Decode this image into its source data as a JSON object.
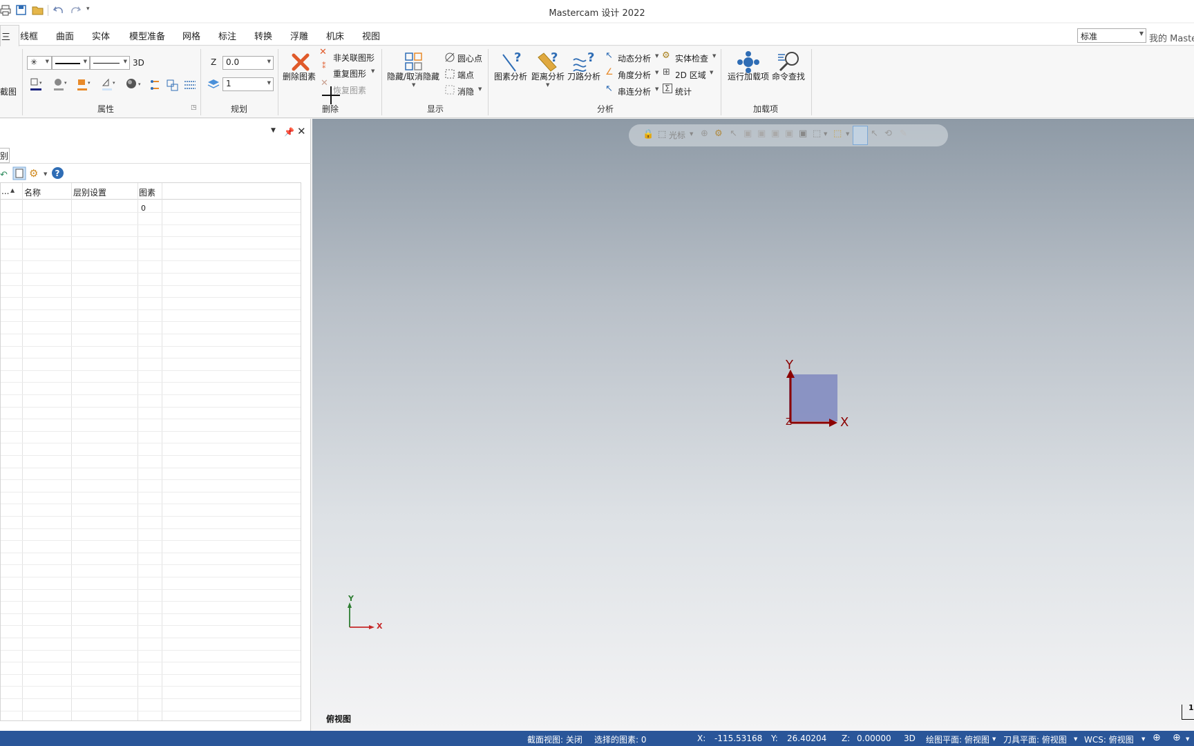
{
  "app": {
    "title": "Mastercam 设计 2022"
  },
  "tabs": [
    "线框",
    "曲面",
    "实体",
    "模型准备",
    "网格",
    "标注",
    "转换",
    "浮雕",
    "机床",
    "视图"
  ],
  "current_tab_fragment": "三",
  "standard_combo": "标准",
  "my_label": "我的 Maste",
  "ribbon": {
    "left_cut_label": "截图",
    "attributes": {
      "label": "属性",
      "point_style": "✳",
      "three_d": "3D"
    },
    "planning": {
      "label": "规划",
      "z_label": "Z",
      "z_value": "0.0",
      "level_value": "1"
    },
    "delete": {
      "label": "删除",
      "delete_entities": "删除图素",
      "non_assoc": "非关联图形",
      "duplicate": "重复图形",
      "restore": "恢复图素"
    },
    "display": {
      "label": "显示",
      "hide_unhide": "隐藏/取消隐藏",
      "center_point": "圆心点",
      "end_point": "端点",
      "blank": "消隐"
    },
    "analyze": {
      "label": "分析",
      "entity": "图素分析",
      "distance": "距离分析",
      "toolpath": "刀路分析",
      "dynamic": "动态分析",
      "angle": "角度分析",
      "chain": "串连分析",
      "solid_check": "实体检查",
      "area_2d": "2D 区域",
      "stats": "统计"
    },
    "addins": {
      "label": "加载项",
      "run_addin": "运行加载项",
      "find_command": "命令查找"
    }
  },
  "levels_panel": {
    "tab_label": "别",
    "columns": [
      "...",
      "名称",
      "层别设置",
      "图素"
    ],
    "row0": {
      "entities": "0"
    }
  },
  "viewport": {
    "toolbar_cursor": "光标",
    "axis_y": "Y",
    "axis_x": "X",
    "axis_z": "Z",
    "mini_y": "Y",
    "mini_x": "X",
    "view_name": "俯视图",
    "edge_marker": "1"
  },
  "status": {
    "section_view": "截面视图: 关闭",
    "selected": "选择的图素: 0",
    "x_label": "X:",
    "x_value": "-115.53168",
    "y_label": "Y:",
    "y_value": "26.40204",
    "z_label": "Z:",
    "z_value": "0.00000",
    "mode": "3D",
    "cplane": "绘图平面: 俯视图",
    "tplane": "刀具平面: 俯视图",
    "wcs": "WCS: 俯视图"
  },
  "colors": {
    "status_bar": "#2a5699",
    "axis_red": "#8b0000",
    "accent_blue": "#2f6db5",
    "box_fill": "#7f88c0"
  }
}
